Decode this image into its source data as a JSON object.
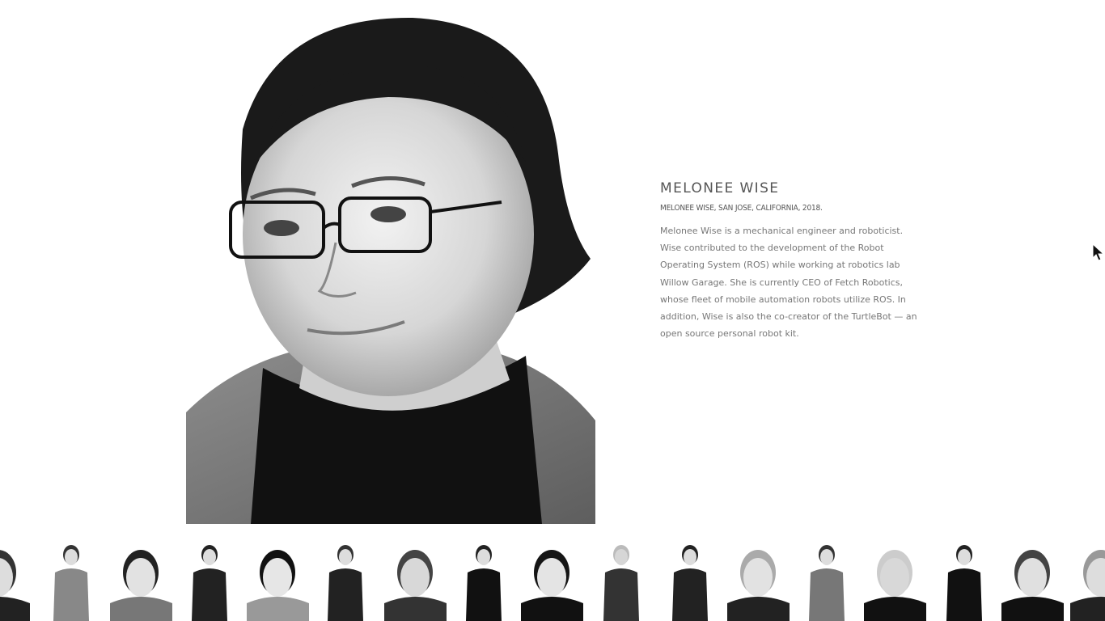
{
  "featured": {
    "name": "MELONEE WISE",
    "caption": "MELONEE WISE, SAN JOSE, CALIFORNIA, 2018.",
    "description": "Melonee Wise is a mechanical engineer and roboticist. Wise contributed to the development of the Robot Operating System (ROS) while working at robotics lab Willow Garage. She is currently CEO of Fetch Robotics, whose fleet of mobile automation robots utilize ROS. In addition, Wise is also the co-creator of the TurtleBot — an open source personal robot kit."
  },
  "gallery": {
    "thumbnail_count": 17,
    "selected_index": 8,
    "style": "black-and-white portraits"
  },
  "colors": {
    "background": "#ffffff",
    "name_text": "#555555",
    "body_text": "#777777"
  }
}
